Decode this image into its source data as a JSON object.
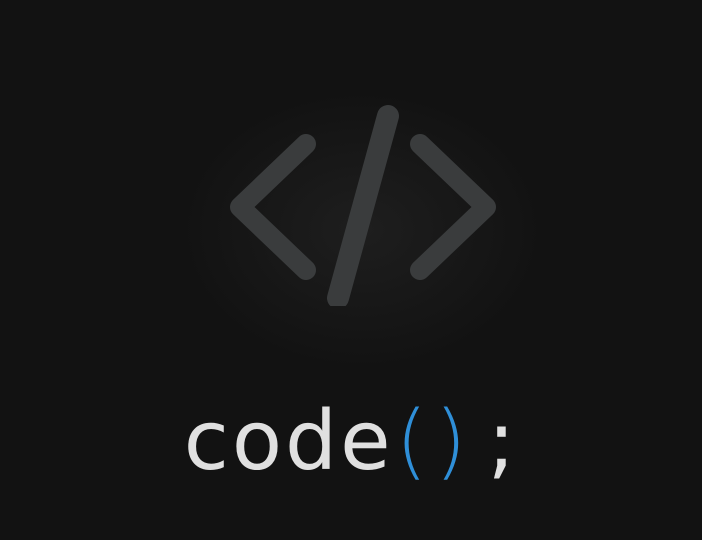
{
  "logo": {
    "icon": "code-brackets-icon",
    "color": "#3a3c3d"
  },
  "wordmark": {
    "word": "code",
    "open_paren": "(",
    "close_paren": ")",
    "semicolon": ";",
    "text_color": "#e0e0e0",
    "accent_color": "#2f8fd8"
  }
}
